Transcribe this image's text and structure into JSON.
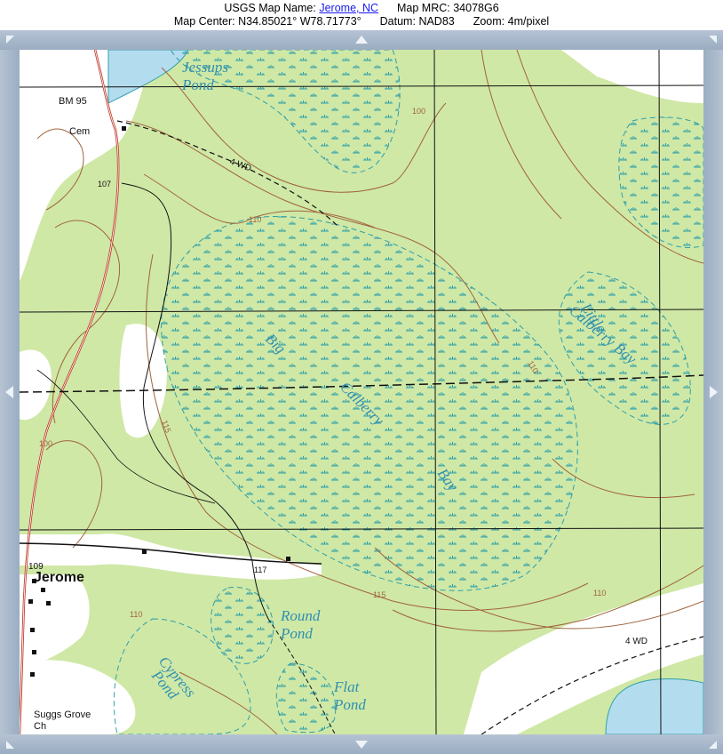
{
  "header": {
    "map_name_label": "USGS Map Name:",
    "map_name_link": "Jerome, NC",
    "mrc_label": "Map MRC:",
    "mrc_value": "34078G6",
    "center_label": "Map Center:",
    "center_lat": "N34.85021°",
    "center_lon": "W78.71773°",
    "datum_label": "Datum:",
    "datum_value": "NAD83",
    "zoom_label": "Zoom:",
    "zoom_value": "4m/pixel"
  },
  "map": {
    "labels": {
      "jessups_1": "Jessups",
      "jessups_2": "Pond",
      "bm": "BM 95",
      "cem": "Cem",
      "road_107": "107",
      "road_4wd_a": "4 WD",
      "contour_100_a": "100",
      "contour_110_a": "110",
      "big": "Big",
      "calberry": "Calberry",
      "bay": "Bay",
      "little": "Little",
      "calberry_bay": "Calberry Bay",
      "contour_110_b": "110",
      "contour_115_a": "115",
      "contour_100_b": "100",
      "road_109": "109",
      "jerome": "Jerome",
      "road_117": "117",
      "contour_115_b": "115",
      "contour_110_c": "110",
      "contour_110_d": "110",
      "round_1": "Round",
      "round_2": "Pond",
      "cypress_1": "Cypress",
      "cypress_2": "Pond",
      "flat_1": "Flat",
      "flat_2": "Pond",
      "road_4wd_b": "4 WD",
      "suggs_1": "Suggs Grove",
      "suggs_2": "Ch"
    },
    "colors": {
      "vegetation": "#cfe8a6",
      "clearing": "#ffffff",
      "water": "#b4dcef",
      "contour": "#a0643c",
      "grid": "#111111",
      "water_label": "#2f8fb0",
      "marsh": "#2f9fa8",
      "road_red": "#c0392b"
    }
  }
}
